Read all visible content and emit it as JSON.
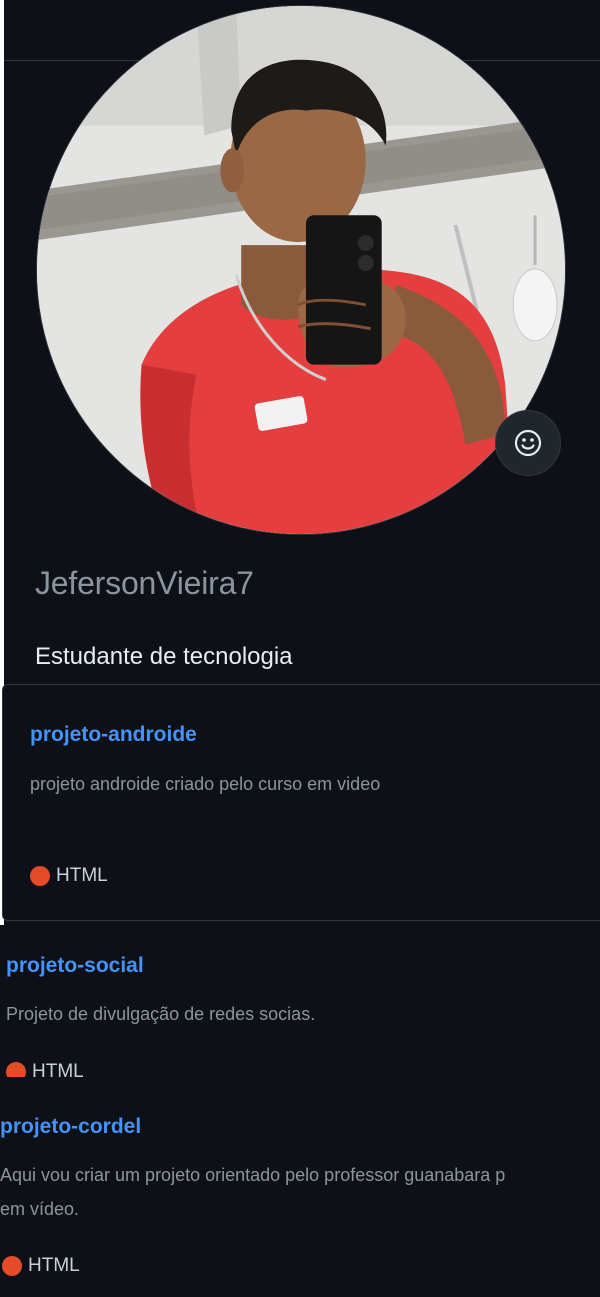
{
  "profile": {
    "username": "JefersonVieira7",
    "bio": "Estudante de tecnologia",
    "avatar_icon": "profile-photo",
    "status_icon": "smiley-icon"
  },
  "repos": [
    {
      "name": "projeto-androide",
      "description": "projeto androide criado pelo curso em video",
      "language": "HTML",
      "language_color": "#e34c26"
    },
    {
      "name": "projeto-social",
      "description": "Projeto de divulgação de redes socias.",
      "language": "HTML",
      "language_color": "#e34c26"
    },
    {
      "name": "projeto-cordel",
      "description_line1": "Aqui vou criar um projeto orientado pelo professor guanabara p",
      "description_line2": "em vídeo.",
      "language": "HTML",
      "language_color": "#e34c26"
    }
  ],
  "colors": {
    "background": "#0d1117",
    "link": "#4493f8",
    "muted": "#8b949e",
    "border": "#30363d"
  }
}
